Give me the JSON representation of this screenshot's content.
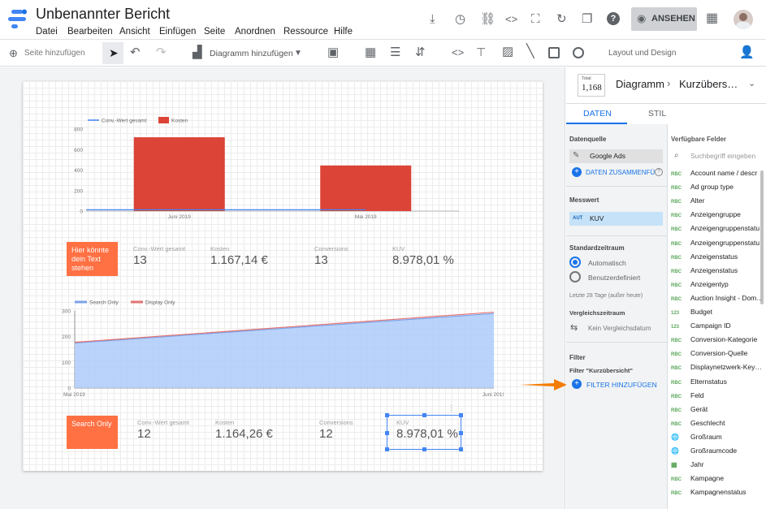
{
  "app": {
    "title": "Unbenannter Bericht",
    "menu": [
      "Datei",
      "Bearbeiten",
      "Ansicht",
      "Einfügen",
      "Seite",
      "Anordnen",
      "Ressource",
      "Hilfe"
    ],
    "view_button": "ANSEHEN"
  },
  "toolbar": {
    "add_page": "Seite hinzufügen",
    "add_chart": "Diagramm hinzufügen",
    "layout": "Layout und Design"
  },
  "chart_data": [
    {
      "type": "bar",
      "categories": [
        "Juni 2019",
        "Mai 2019"
      ],
      "series": [
        {
          "name": "Conv.-Wert gesamt",
          "values": [
            13,
            13
          ]
        },
        {
          "name": "Kosten",
          "values": [
            720,
            445
          ]
        }
      ],
      "ylim": [
        0,
        800
      ],
      "yticks": [
        "800",
        "600",
        "400",
        "200",
        "0"
      ],
      "legend": "top-left"
    },
    {
      "type": "area",
      "x": [
        "Mai 2019",
        "Juni 2019"
      ],
      "series": [
        {
          "name": "Search Only",
          "values": [
            175,
            290
          ]
        },
        {
          "name": "Display Only",
          "values": [
            178,
            295
          ]
        }
      ],
      "ylim": [
        0,
        300
      ],
      "yticks": [
        "300",
        "200",
        "100",
        "0"
      ],
      "legend": "top-left"
    }
  ],
  "sc1": {
    "note": "Hier könnte dein Text stehen",
    "l1": "Conv.-Wert gesamt",
    "v1": "13",
    "l2": "Kosten",
    "v2": "1.167,14 €",
    "l3": "Conversions",
    "v3": "13",
    "l4": "KUV",
    "v4": "8.978,01 %"
  },
  "sc2": {
    "note": "Search Only",
    "l1": "Conv.-Wert gesamt",
    "v1": "12",
    "l2": "Kosten",
    "v2": "1.164,26 €",
    "l3": "Conversions",
    "v3": "12",
    "l4": "KUV",
    "v4": "8.978,01 %"
  },
  "panel": {
    "total_label": "Total",
    "total_value": "1,168",
    "crumb1": "Diagramm",
    "crumb2": "Kurzübers…",
    "tab_data": "DATEN",
    "tab_style": "STIL",
    "ds_title": "Datenquelle",
    "ds_value": "Google Ads",
    "blend": "DATEN ZUSAMMENFÜ",
    "metric_title": "Messwert",
    "metric_type": "AUT",
    "metric_value": "KUV",
    "range_title": "Standardzeitraum",
    "range_auto": "Automatisch",
    "range_custom": "Benutzerdefiniert",
    "range_note": "Letzte 28 Tage (außer heute)",
    "cmp_title": "Vergleichszeitraum",
    "cmp_value": "Kein Vergleichsdatum",
    "filter_title": "Filter",
    "filter_sub": "Filter \"Kurzübersicht\"",
    "filter_add": "FILTER HINZUFÜGEN",
    "fields_title": "Verfügbare Felder",
    "search_placeholder": "Suchbegriff eingeben"
  },
  "fields": [
    {
      "t": "RBC",
      "n": "Account name / descr"
    },
    {
      "t": "RBC",
      "n": "Ad group type"
    },
    {
      "t": "RBC",
      "n": "Alter"
    },
    {
      "t": "RBC",
      "n": "Anzeigengruppe"
    },
    {
      "t": "RBC",
      "n": "Anzeigengruppenstatu"
    },
    {
      "t": "RBC",
      "n": "Anzeigengruppenstatu"
    },
    {
      "t": "RBC",
      "n": "Anzeigenstatus"
    },
    {
      "t": "RBC",
      "n": "Anzeigenstatus"
    },
    {
      "t": "RBC",
      "n": "Anzeigentyp"
    },
    {
      "t": "RBC",
      "n": "Auction Insight - Dom…"
    },
    {
      "t": "123",
      "n": "Budget"
    },
    {
      "t": "123",
      "n": "Campaign ID"
    },
    {
      "t": "RBC",
      "n": "Conversion-Kategorie"
    },
    {
      "t": "RBC",
      "n": "Conversion-Quelle"
    },
    {
      "t": "RBC",
      "n": "Displaynetzwerk-Key…"
    },
    {
      "t": "RBC",
      "n": "Elternstatus"
    },
    {
      "t": "RBC",
      "n": "Feld"
    },
    {
      "t": "RBC",
      "n": "Gerät"
    },
    {
      "t": "RBC",
      "n": "Geschlecht"
    },
    {
      "t": "GEO",
      "n": "Großraum"
    },
    {
      "t": "GEO",
      "n": "Großraumcode"
    },
    {
      "t": "CAL",
      "n": "Jahr"
    },
    {
      "t": "RBC",
      "n": "Kampagne"
    },
    {
      "t": "RBC",
      "n": "Kampagnenstatus"
    }
  ]
}
